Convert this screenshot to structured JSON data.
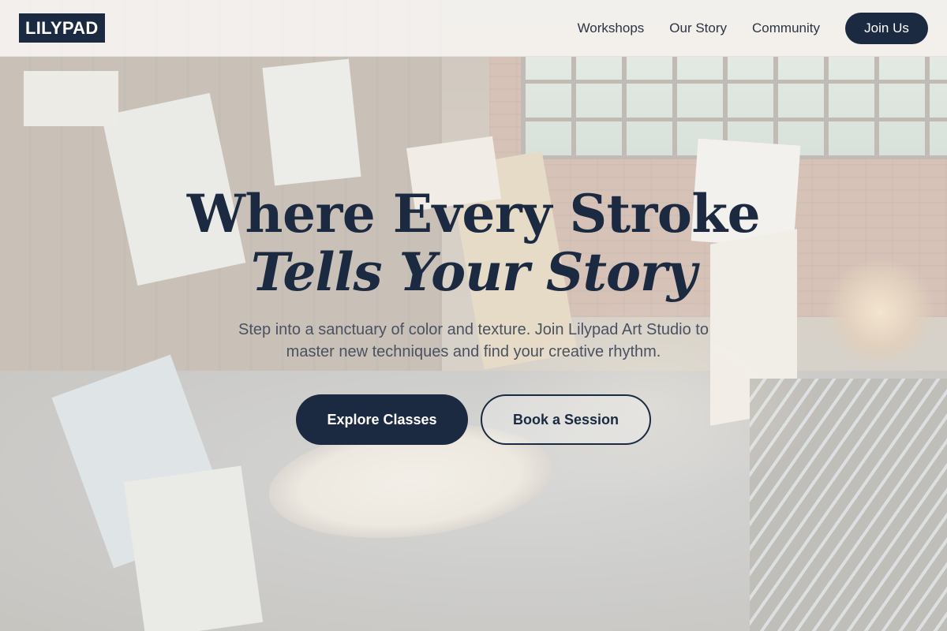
{
  "brand": {
    "logo_text": "LILYPAD"
  },
  "nav": {
    "links": [
      "Workshops",
      "Our Story",
      "Community"
    ],
    "cta_label": "Join Us"
  },
  "hero": {
    "title_line1": "Where Every Stroke",
    "title_line2": "Tells Your Story",
    "subtitle": "Step into a sanctuary of color and texture. Join Lilypad Art Studio to master new techniques and find your creative rhythm.",
    "primary_button": "Explore Classes",
    "secondary_button": "Book a Session"
  },
  "colors": {
    "accent": "#1b2a40",
    "overlay": "#f4f1ec",
    "text_muted": "#4a5160"
  },
  "background_image": "art studio interior with canvases and brick wall"
}
